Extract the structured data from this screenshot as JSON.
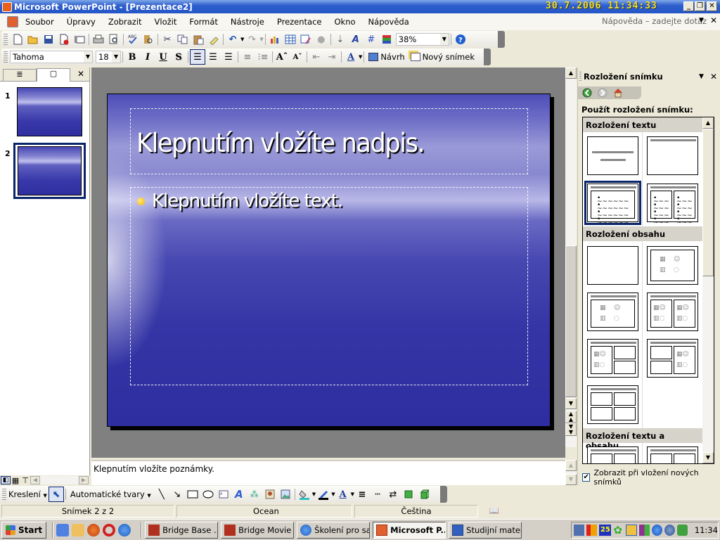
{
  "window": {
    "title": "Microsoft PowerPoint - [Prezentace2]",
    "clock_overlay": "30.7.2006   11:34:33",
    "controls": {
      "minimize": "_",
      "restore": "❐",
      "close": "✕"
    }
  },
  "menubar": {
    "items": [
      "Soubor",
      "Úpravy",
      "Zobrazit",
      "Vložit",
      "Formát",
      "Nástroje",
      "Prezentace",
      "Okno",
      "Nápověda"
    ],
    "help_placeholder": "Nápověda – zadejte dotaz"
  },
  "standard_toolbar": {
    "icons": [
      "new-icon",
      "open-icon",
      "save-icon",
      "permission-icon",
      "email-icon",
      "print-icon",
      "print-preview-icon",
      "spelling-icon",
      "research-icon",
      "cut-icon",
      "copy-icon",
      "paste-icon",
      "format-painter-icon",
      "undo-icon",
      "redo-icon",
      "insert-chart-icon",
      "insert-table-icon",
      "tables-borders-icon",
      "insert-hyperlink-icon",
      "expand-all-icon",
      "show-formatting-icon",
      "grid-icon",
      "color-grayscale-icon",
      "help-icon"
    ],
    "zoom": "38%"
  },
  "formatting_toolbar": {
    "font": "Tahoma",
    "size": "18",
    "bold": "B",
    "italic": "I",
    "underline": "U",
    "shadow": "S",
    "design_label": "Návrh",
    "new_slide_label": "Nový snímek"
  },
  "slides_pane": {
    "tabs": [
      "outline-tab",
      "slides-tab"
    ],
    "slides": [
      {
        "number": "1",
        "selected": false
      },
      {
        "number": "2",
        "selected": true
      }
    ]
  },
  "slide": {
    "title_placeholder": "Klepnutím vložíte nadpis.",
    "body_placeholder": "Klepnutím vložíte text."
  },
  "notes": {
    "placeholder": "Klepnutím vložíte poznámky."
  },
  "task_pane": {
    "title": "Rozložení snímku",
    "subtitle": "Použít rozložení snímku:",
    "categories": [
      {
        "name": "Rozložení textu"
      },
      {
        "name": "Rozložení obsahu"
      },
      {
        "name": "Rozložení textu a obsahu"
      }
    ],
    "show_on_insert_label": "Zobrazit při vložení nových snímků",
    "show_on_insert_checked": true
  },
  "drawing_toolbar": {
    "draw_label": "Kreslení",
    "autoshapes_label": "Automatické tvary"
  },
  "statusbar": {
    "slide_info": "Snímek 2 z 2",
    "design": "Ocean",
    "language": "Čeština"
  },
  "taskbar": {
    "start_label": "Start",
    "tasks": [
      {
        "label": "Bridge Base ...",
        "active": false
      },
      {
        "label": "Bridge Movie",
        "active": false
      },
      {
        "label": "Školení pro sa...",
        "active": false
      },
      {
        "label": "Microsoft P...",
        "active": true
      },
      {
        "label": "Studijní mater...",
        "active": false
      }
    ],
    "tray_badge": "25",
    "clock": "11:34"
  }
}
